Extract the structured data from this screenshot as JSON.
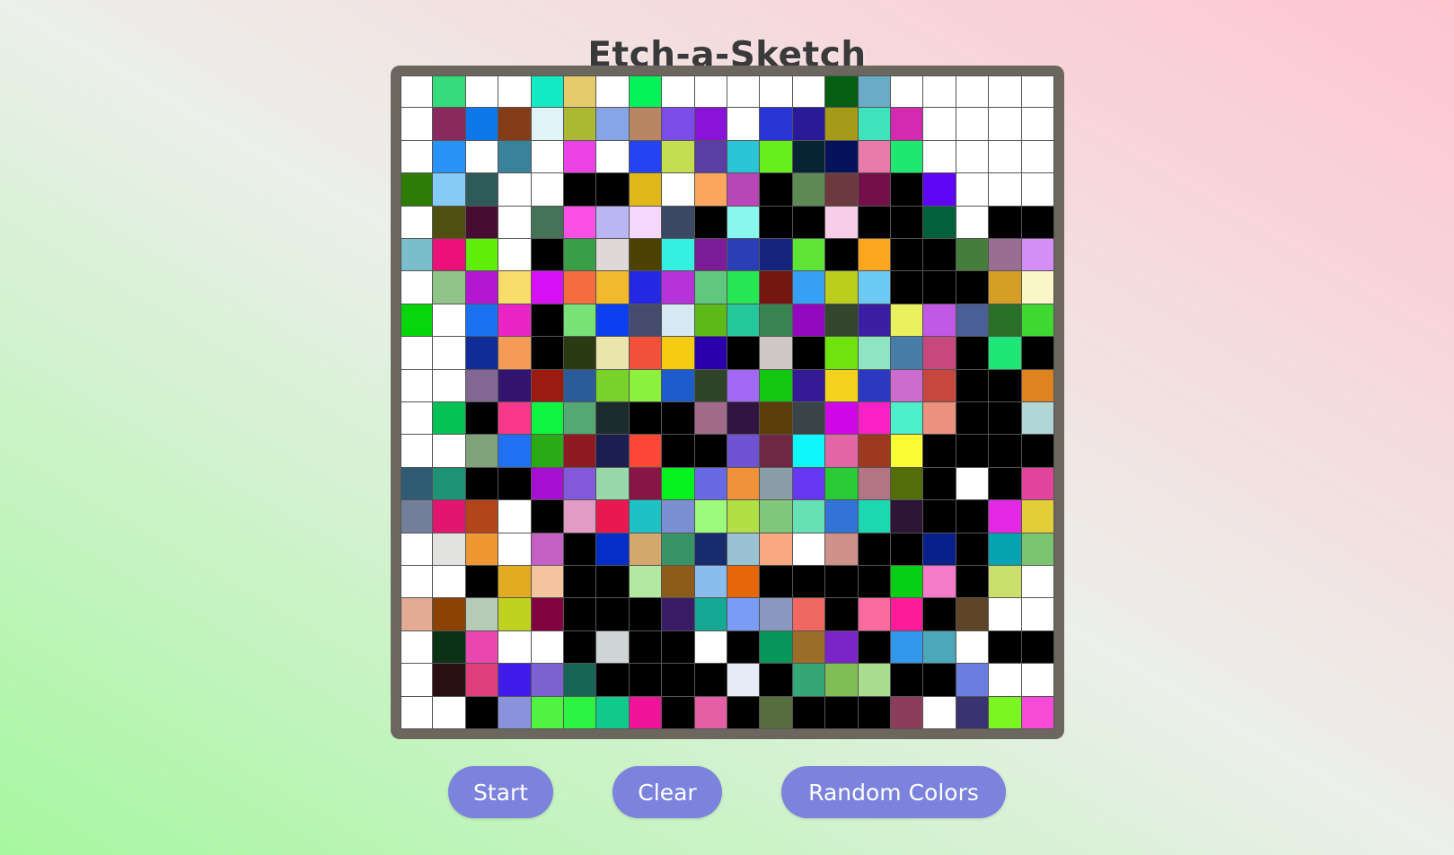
{
  "title": "Etch-a-Sketch",
  "grid": {
    "rows": 20,
    "cols": 20,
    "cells": [
      [
        "#ffffff",
        "#36db7c",
        "#ffffff",
        "#ffffff",
        "#12ebc3",
        "#e6cb6c",
        "#ffffff",
        "#06f25a",
        "#ffffff",
        "#ffffff",
        "#ffffff",
        "#ffffff",
        "#ffffff",
        "#055f12",
        "#6aabc6",
        "#ffffff",
        "#ffffff",
        "#ffffff",
        "#ffffff",
        "#ffffff"
      ],
      [
        "#ffffff",
        "#8a2a5c",
        "#0c78ea",
        "#843d18",
        "#e0f4f8",
        "#aab834",
        "#86a5e6",
        "#b98663",
        "#7a4de8",
        "#8913d6",
        "#ffffff",
        "#2935d6",
        "#2a1a98",
        "#a59a1a",
        "#3fe3bb",
        "#d42aaf",
        "#ffffff",
        "#ffffff",
        "#ffffff",
        "#ffffff"
      ],
      [
        "#ffffff",
        "#2894f7",
        "#ffffff",
        "#3a8299",
        "#ffffff",
        "#ec43e6",
        "#ffffff",
        "#2444f4",
        "#c5dd50",
        "#5b3ea3",
        "#2ac4d6",
        "#67ef1c",
        "#072435",
        "#06125a",
        "#e87aab",
        "#1ee86f",
        "#ffffff",
        "#ffffff",
        "#ffffff",
        "#ffffff"
      ],
      [
        "#2e7b05",
        "#84ccf5",
        "#2f5a5a",
        "#ffffff",
        "#ffffff",
        "#000000",
        "#000000",
        "#e2b71a",
        "#ffffff",
        "#fca55e",
        "#b946b6",
        "#000000",
        "#5f8a55",
        "#6c3a3e",
        "#73104a",
        "#000000",
        "#5f06f6",
        "#ffffff",
        "#ffffff",
        "#ffffff"
      ],
      [
        "#ffffff",
        "#4f5010",
        "#480c32",
        "#ffffff",
        "#457358",
        "#fb4fe5",
        "#b9b6f2",
        "#f5d6fc",
        "#3b4863",
        "#000000",
        "#88f8ee",
        "#000000",
        "#000000",
        "#f8cdea",
        "#000000",
        "#000000",
        "#045f3d",
        "#ffffff",
        "#000000",
        "#000000"
      ],
      [
        "#7bbecb",
        "#ec1179",
        "#5fee0a",
        "#ffffff",
        "#000000",
        "#3a9e46",
        "#e0d8d8",
        "#4c4303",
        "#35efe0",
        "#7a1d96",
        "#2a3fb6",
        "#16247d",
        "#5ee434",
        "#000000",
        "#fba61c",
        "#000000",
        "#000000",
        "#467d3d",
        "#9a6e93",
        "#d68ef7"
      ],
      [
        "#ffffff",
        "#8fc388",
        "#b317d2",
        "#f9dd6a",
        "#d710f8",
        "#f36d3f",
        "#f1b92e",
        "#2528e2",
        "#b633da",
        "#60c87d",
        "#26e654",
        "#761611",
        "#36a0f5",
        "#bccd1d",
        "#6dcaf5",
        "#000000",
        "#000000",
        "#000000",
        "#d59e24",
        "#fbf6c8"
      ],
      [
        "#06d60c",
        "#ffffff",
        "#1b72f0",
        "#ea25c6",
        "#000000",
        "#78e276",
        "#0b3ff0",
        "#454b6c",
        "#d6e8f1",
        "#5eba18",
        "#25c89c",
        "#378451",
        "#9308c0",
        "#33452d",
        "#3a1ea3",
        "#e9f25e",
        "#c158e6",
        "#4b5f97",
        "#2a6f27",
        "#3fd833"
      ],
      [
        "#ffffff",
        "#ffffff",
        "#102d97",
        "#f39b57",
        "#000000",
        "#2a3a13",
        "#e9e5ac",
        "#f3503b",
        "#f5ca12",
        "#2a00aa",
        "#000000",
        "#cdc7c6",
        "#000000",
        "#6fe40c",
        "#90e4c6",
        "#487da7",
        "#c7477f",
        "#000000",
        "#1ee677",
        "#000000"
      ],
      [
        "#ffffff",
        "#ffffff",
        "#826793",
        "#331370",
        "#9b1b10",
        "#2a5c99",
        "#79d229",
        "#8cf13e",
        "#1c5dcb",
        "#2f4328",
        "#a269f7",
        "#13c60e",
        "#341a95",
        "#f3d21e",
        "#2b39c1",
        "#cd6bd0",
        "#c5473e",
        "#000000",
        "#000000",
        "#df8320"
      ],
      [
        "#ffffff",
        "#06c153",
        "#000000",
        "#fb3789",
        "#0ef440",
        "#54a872",
        "#1c2c2e",
        "#000000",
        "#000000",
        "#a26b8a",
        "#321442",
        "#5c3d0a",
        "#394448",
        "#d008e8",
        "#fb20c6",
        "#4cefc9",
        "#ec917e",
        "#000000",
        "#000000",
        "#b0d6d8"
      ],
      [
        "#ffffff",
        "#ffffff",
        "#7fa27b",
        "#2170f3",
        "#2aaa15",
        "#8f1b22",
        "#1a1e51",
        "#fd4636",
        "#000000",
        "#000000",
        "#6e53d2",
        "#6e2841",
        "#0ef7fd",
        "#e266a5",
        "#9c3920",
        "#fbfb34",
        "#000000",
        "#000000",
        "#000000",
        "#000000"
      ],
      [
        "#2f5b73",
        "#1d9275",
        "#000000",
        "#000000",
        "#a70fd2",
        "#8259d8",
        "#98d8aa",
        "#871546",
        "#04f21e",
        "#6969e6",
        "#f1913a",
        "#8a9ea8",
        "#6637f2",
        "#28ca35",
        "#b27583",
        "#536e09",
        "#000000",
        "#ffffff",
        "#000000",
        "#e0449d"
      ],
      [
        "#72809c",
        "#e1166f",
        "#b2461a",
        "#ffffff",
        "#000000",
        "#e29bc2",
        "#e91851",
        "#1ec2c4",
        "#7b8fd2",
        "#9df97a",
        "#b0e043",
        "#81c779",
        "#66e1b6",
        "#3173d7",
        "#1cd8b0",
        "#2d1537",
        "#000000",
        "#000000",
        "#e428e6",
        "#e2cf38"
      ],
      [
        "#ffffff",
        "#e2e2e0",
        "#ef9831",
        "#ffffff",
        "#c460c4",
        "#000000",
        "#032ec8",
        "#d4a76c",
        "#389466",
        "#162c6d",
        "#9bc2d2",
        "#f8a97f",
        "#ffffff",
        "#cd9189",
        "#000000",
        "#000000",
        "#07208a",
        "#000000",
        "#03a3b1",
        "#7dc470"
      ],
      [
        "#ffffff",
        "#ffffff",
        "#000000",
        "#e2ac20",
        "#f5c39d",
        "#000000",
        "#000000",
        "#b3e8a0",
        "#8c5c18",
        "#8bbcee",
        "#e6670a",
        "#000000",
        "#000000",
        "#000000",
        "#000000",
        "#07d014",
        "#f57ac8",
        "#000000",
        "#cbe06a",
        "#ffffff"
      ],
      [
        "#e3ab94",
        "#8c4105",
        "#b6cbb6",
        "#c0d220",
        "#82043f",
        "#000000",
        "#000000",
        "#000000",
        "#3a1c66",
        "#14a895",
        "#7b9cf4",
        "#8a97bf",
        "#f16861",
        "#000000",
        "#fd6a9f",
        "#fd1b9a",
        "#000000",
        "#5e4528",
        "#ffffff",
        "#ffffff"
      ],
      [
        "#ffffff",
        "#0b3117",
        "#e947ae",
        "#ffffff",
        "#ffffff",
        "#000000",
        "#cfd4d4",
        "#000000",
        "#000000",
        "#ffffff",
        "#000000",
        "#09965a",
        "#9a6d29",
        "#7a25c8",
        "#000000",
        "#3398ed",
        "#4aa8b9",
        "#ffffff",
        "#000000",
        "#000000"
      ],
      [
        "#ffffff",
        "#2a1010",
        "#e03f7c",
        "#411be9",
        "#7c62cf",
        "#166557",
        "#000000",
        "#000000",
        "#000000",
        "#000000",
        "#e6ebf7",
        "#000000",
        "#35a676",
        "#80be55",
        "#a8dd90",
        "#000000",
        "#000000",
        "#6a7edf",
        "#ffffff",
        "#ffffff"
      ],
      [
        "#ffffff",
        "#ffffff",
        "#000000",
        "#8b93dd",
        "#51f341",
        "#2df442",
        "#10c98b",
        "#ef149a",
        "#000000",
        "#e45ea6",
        "#000000",
        "#586d3d",
        "#000000",
        "#000000",
        "#000000",
        "#8b3d5b",
        "#ffffff",
        "#3a336f",
        "#7bf622",
        "#f74ad6"
      ]
    ]
  },
  "buttons": {
    "start": "Start",
    "clear": "Clear",
    "random": "Random Colors"
  }
}
